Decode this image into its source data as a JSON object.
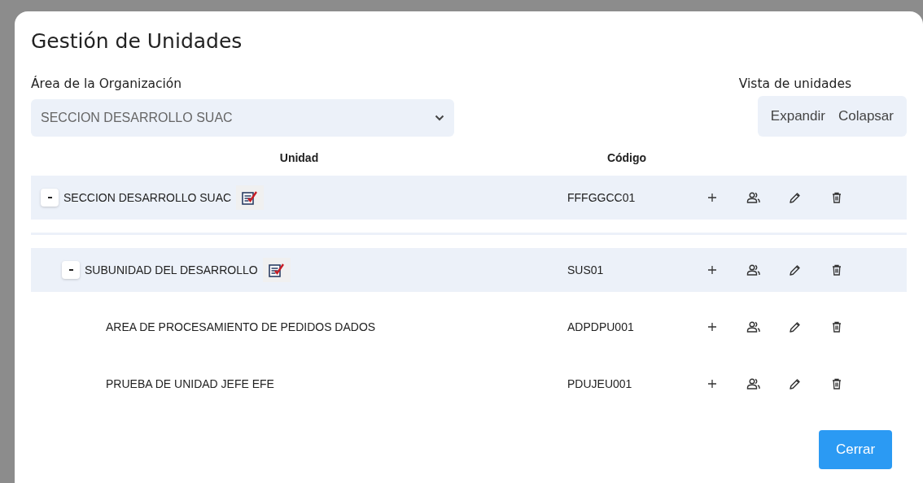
{
  "title": "Gestión de Unidades",
  "area": {
    "label": "Área de la Organización",
    "value": "SECCION DESARROLLO SUAC"
  },
  "view": {
    "label": "Vista de unidades",
    "buttons": [
      "Expandir",
      "Colapsar"
    ]
  },
  "table": {
    "columns": [
      "Unidad",
      "Código"
    ],
    "rows": [
      {
        "name": "SECCION DESARROLLO SUAC",
        "code": "FFFGGCC01",
        "expanded": true,
        "children": [
          {
            "name": "SUBUNIDAD DEL DESARROLLO",
            "code": "SUS01",
            "expanded": true,
            "children": [
              {
                "name": "AREA DE PROCESAMIENTO DE PEDIDOS DADOS",
                "code": "ADPDPU001"
              },
              {
                "name": "PRUEBA DE UNIDAD JEFE EFE",
                "code": "PDUJEU001"
              }
            ]
          }
        ]
      }
    ]
  },
  "buttons": [
    "Cerrar"
  ]
}
